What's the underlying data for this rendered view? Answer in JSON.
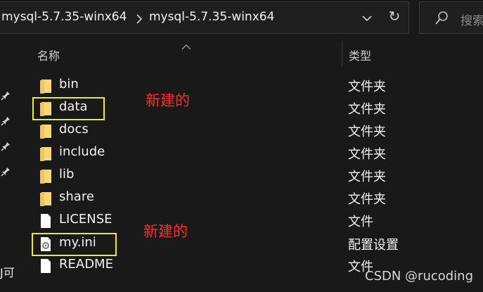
{
  "address_bar": {
    "crumbs": [
      "mysql-5.7.35-winx64",
      "mysql-5.7.35-winx64"
    ]
  },
  "search": {
    "placeholder": "搜索"
  },
  "header": {
    "name_label": "名称",
    "type_label": "类型"
  },
  "files": [
    {
      "name": "bin",
      "type": "文件夹",
      "icon": "folder-icon"
    },
    {
      "name": "data",
      "type": "文件夹",
      "icon": "folder-icon"
    },
    {
      "name": "docs",
      "type": "文件夹",
      "icon": "folder-icon"
    },
    {
      "name": "include",
      "type": "文件夹",
      "icon": "folder-icon"
    },
    {
      "name": "lib",
      "type": "文件夹",
      "icon": "folder-icon"
    },
    {
      "name": "share",
      "type": "文件夹",
      "icon": "folder-icon"
    },
    {
      "name": "LICENSE",
      "type": "文件",
      "icon": "file-icon"
    },
    {
      "name": "my.ini",
      "type": "配置设置",
      "icon": "config-file-icon"
    },
    {
      "name": "README",
      "type": "文件",
      "icon": "file-icon"
    }
  ],
  "annotations": {
    "note_data": "新建的",
    "note_myini": "新建的"
  },
  "left_nav": {
    "partial_text": "J可"
  },
  "watermark": "CSDN @rucoding",
  "colors": {
    "background": "#191919",
    "folder": "#f3c55a",
    "highlight_box": "#f4ea26",
    "annotation_text": "#ff2d2d"
  }
}
